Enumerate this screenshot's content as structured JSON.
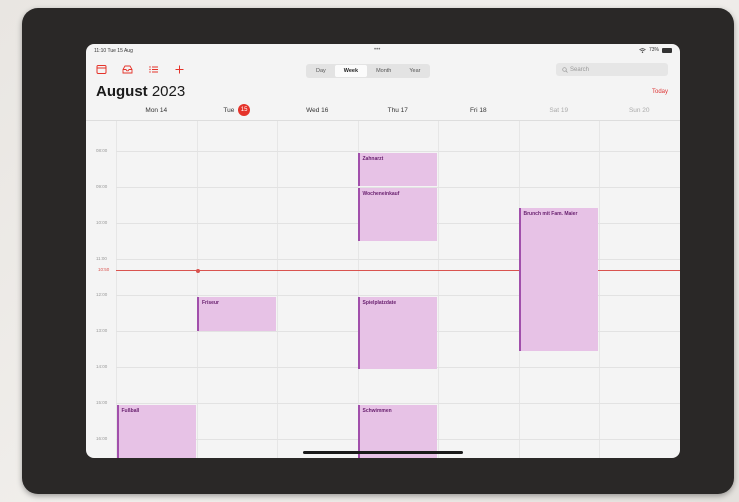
{
  "status": {
    "time": "11:10",
    "date": "Tue 15 Aug",
    "dots": "•••",
    "battery": "73%"
  },
  "toolbar": {
    "icons": [
      "calendar-icon",
      "inbox-icon",
      "list-icon",
      "add-icon"
    ],
    "views": [
      "Day",
      "Week",
      "Month",
      "Year"
    ],
    "active_view": "Week",
    "search_placeholder": "Search"
  },
  "header": {
    "month": "August",
    "year": "2023",
    "today_label": "Today"
  },
  "days": [
    {
      "label": "Mon 14"
    },
    {
      "label": "Tue",
      "badge": "15"
    },
    {
      "label": "Wed 16"
    },
    {
      "label": "Thu 17"
    },
    {
      "label": "Fri 18"
    },
    {
      "label": "Sat 19"
    },
    {
      "label": "Sun 20"
    }
  ],
  "hours": [
    "08:00",
    "09:00",
    "10:00",
    "11:00",
    "12:00",
    "13:00",
    "14:00",
    "15:00",
    "16:00"
  ],
  "now_label": "10:50",
  "events": [
    {
      "title": "Zahnarzt",
      "day": "Thu 17"
    },
    {
      "title": "Wocheneinkauf",
      "day": "Thu 17"
    },
    {
      "title": "Brunch mit Fam. Maier",
      "day": "Sat 19"
    },
    {
      "title": "Friseur",
      "day": "Tue 15"
    },
    {
      "title": "Spielplatzdate",
      "day": "Thu 17"
    },
    {
      "title": "Fußball",
      "day": "Mon 14"
    },
    {
      "title": "Schwimmen",
      "day": "Thu 17"
    }
  ],
  "colors": {
    "event_fill": "#e7c2e6",
    "event_border": "#a14fab",
    "accent_red": "#e5332a"
  }
}
